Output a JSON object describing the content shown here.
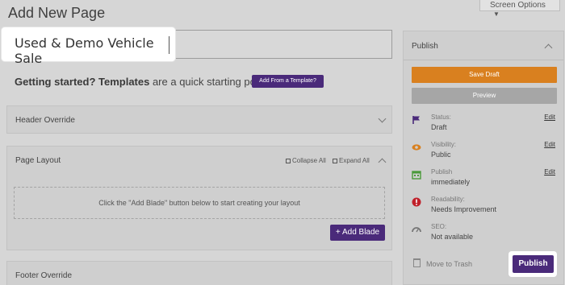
{
  "page": {
    "title": "Add New Page",
    "screen_options_label": "Screen Options",
    "post_title_value": "Used & Demo Vehicle Sale"
  },
  "templates": {
    "lead_bold": "Getting started? Templates",
    "lead_rest": " are a quick starting point.",
    "button_label": "Add From a Template?"
  },
  "panels": {
    "header_override": "Header Override",
    "page_layout": {
      "title": "Page Layout",
      "collapse_all": "Collapse All",
      "expand_all": "Expand All",
      "empty_message": "Click the \"Add Blade\" button below to start creating your layout",
      "add_blade_label": "+ Add Blade"
    },
    "footer_override": "Footer Override"
  },
  "publish": {
    "title": "Publish",
    "save_draft": "Save Draft",
    "preview": "Preview",
    "rows": [
      {
        "label": "Status:",
        "value": "Draft",
        "edit": "Edit",
        "icon": "flag-icon"
      },
      {
        "label": "Visibility:",
        "value": "Public",
        "edit": "Edit",
        "icon": "eye-icon"
      },
      {
        "label": "Publish",
        "value": "immediately",
        "edit": "Edit",
        "icon": "calendar-icon"
      },
      {
        "label": "Readability:",
        "value": "Needs Improvement",
        "edit": "",
        "icon": "alert-icon"
      },
      {
        "label": "SEO:",
        "value": "Not available",
        "edit": "",
        "icon": "gauge-icon"
      }
    ],
    "move_to_trash": "Move to Trash",
    "publish_button": "Publish"
  },
  "colors": {
    "brand_purple": "#4a2a7a",
    "save_orange": "#d9801f",
    "preview_gray": "#a6a6a6"
  }
}
